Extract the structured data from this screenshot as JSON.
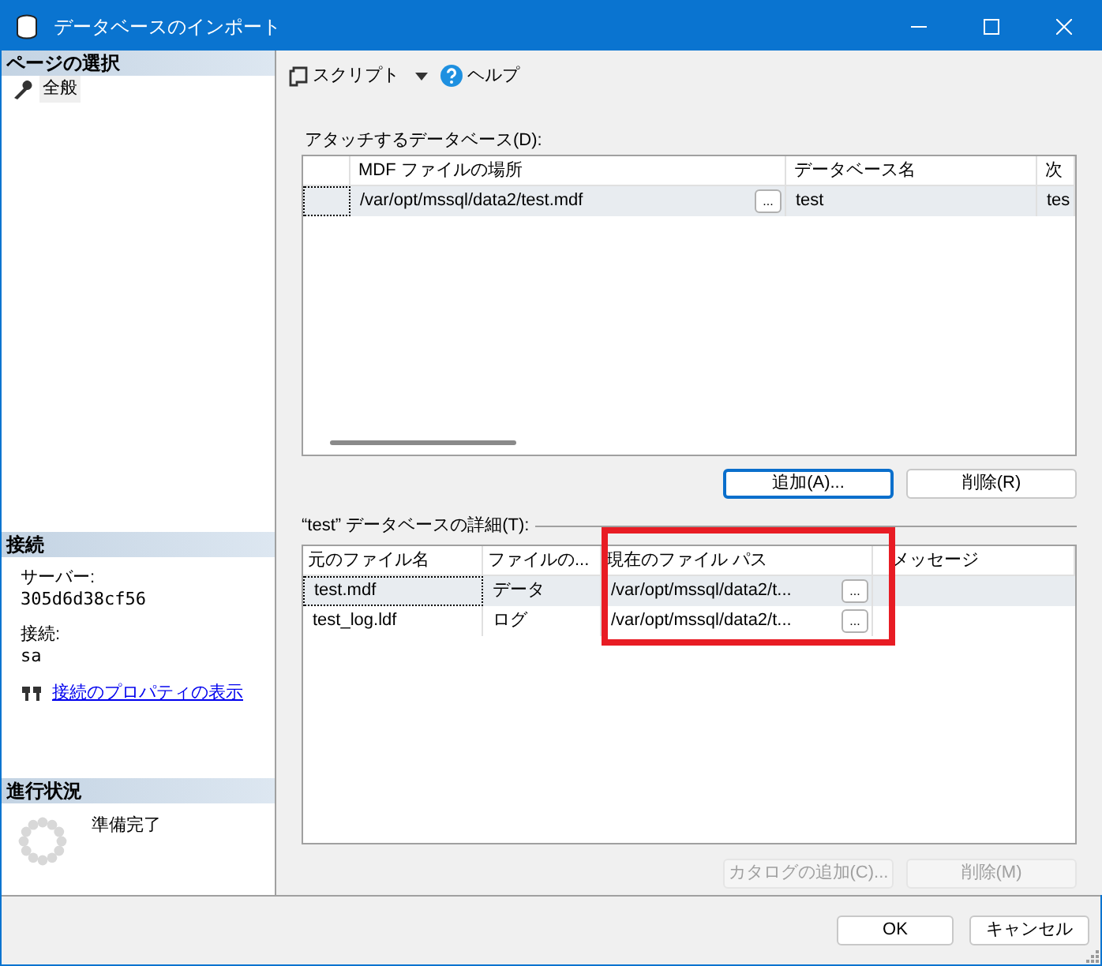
{
  "window": {
    "title": "データベースのインポート"
  },
  "sidebar": {
    "page_select": {
      "title": "ページの選択",
      "items": [
        {
          "label": "全般",
          "selected": true
        }
      ]
    },
    "connection": {
      "title": "接続",
      "server_label": "サーバー:",
      "server": "305d6d38cf56",
      "connection_label": "接続:",
      "user": "sa",
      "link": "接続のプロパティの表示"
    },
    "progress": {
      "title": "進行状況",
      "status": "準備完了"
    }
  },
  "toolbar": {
    "script": "スクリプト",
    "help": "ヘルプ"
  },
  "attach": {
    "label": "アタッチするデータベース(D):",
    "columns": [
      "MDF ファイルの場所",
      "データベース名",
      "次"
    ],
    "rows": [
      {
        "cells": [
          "/var/opt/mssql/data2/test.mdf",
          "test",
          "tes"
        ],
        "browse": "...",
        "selected": true
      }
    ],
    "buttons": [
      {
        "label": "追加(A)...",
        "focused": true
      },
      {
        "label": "削除(R)",
        "focused": false
      }
    ]
  },
  "details": {
    "label": "“test” データベースの詳細(T):",
    "columns": [
      "元のファイル名",
      "ファイルの...",
      "現在のファイル パス",
      "メッセージ"
    ],
    "rows": [
      {
        "name": "test.mdf",
        "type": "データ",
        "path": "/var/opt/mssql/data2/t...",
        "browse": "...",
        "selected": true
      },
      {
        "name": "test_log.ldf",
        "type": "ログ",
        "path": "/var/opt/mssql/data2/t...",
        "browse": "...",
        "selected": false
      }
    ],
    "buttons": [
      {
        "label": "カタログの追加(C)...",
        "disabled": true
      },
      {
        "label": "削除(M)",
        "disabled": true
      }
    ]
  },
  "annotation": {
    "kind": "box"
  },
  "footer": {
    "buttons": [
      "OK",
      "キャンセル"
    ]
  }
}
